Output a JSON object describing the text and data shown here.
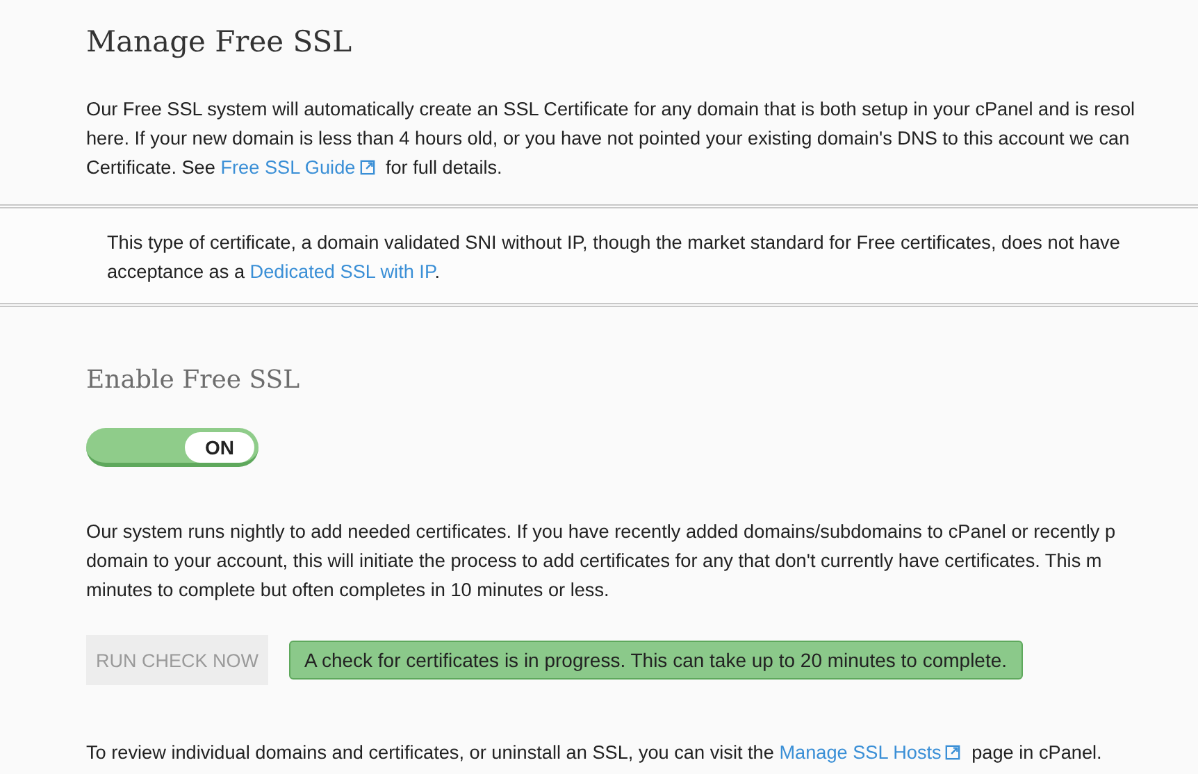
{
  "title": "Manage Free SSL",
  "intro": [
    [
      {
        "kind": "text",
        "text": "Our Free SSL system will automatically create an SSL Certificate for any domain that is both setup in your cPanel and is resol"
      }
    ],
    [
      {
        "kind": "text",
        "text": "here. If your new domain is less than 4 hours old, or you have not pointed your existing domain's DNS to this account we can"
      }
    ],
    [
      {
        "kind": "text",
        "text": "Certificate. See "
      },
      {
        "kind": "link",
        "text": "Free SSL Guide"
      },
      {
        "kind": "text",
        "text": " for full details."
      }
    ]
  ],
  "notice": [
    [
      {
        "kind": "text",
        "text": "This type of certificate, a domain validated SNI without IP, though the market standard for Free certificates, does not have"
      }
    ],
    [
      {
        "kind": "text",
        "text": "acceptance as a "
      },
      {
        "kind": "link",
        "text": "Dedicated SSL with IP"
      },
      {
        "kind": "text",
        "text": "."
      }
    ]
  ],
  "enable_heading": "Enable Free SSL",
  "toggle": {
    "label": "ON",
    "on": true
  },
  "nightly": [
    [
      {
        "kind": "text",
        "text": "Our system runs nightly to add needed certificates. If you have recently added domains/subdomains to cPanel or recently p"
      }
    ],
    [
      {
        "kind": "text",
        "text": "domain to your account, this will initiate the process to add certificates for any that don't currently have certificates. This m"
      }
    ],
    [
      {
        "kind": "text",
        "text": "minutes to complete but often completes in 10 minutes or less."
      }
    ]
  ],
  "run_button": {
    "label": "RUN CHECK NOW",
    "disabled": true
  },
  "alert": "A check for certificates is in progress. This can take up to 20 minutes to complete.",
  "footer": [
    [
      {
        "kind": "text",
        "text": "To review individual domains and certificates, or uninstall an SSL, you can visit the "
      },
      {
        "kind": "link",
        "text": "Manage SSL Hosts"
      },
      {
        "kind": "text",
        "text": " page in cPanel."
      }
    ]
  ]
}
